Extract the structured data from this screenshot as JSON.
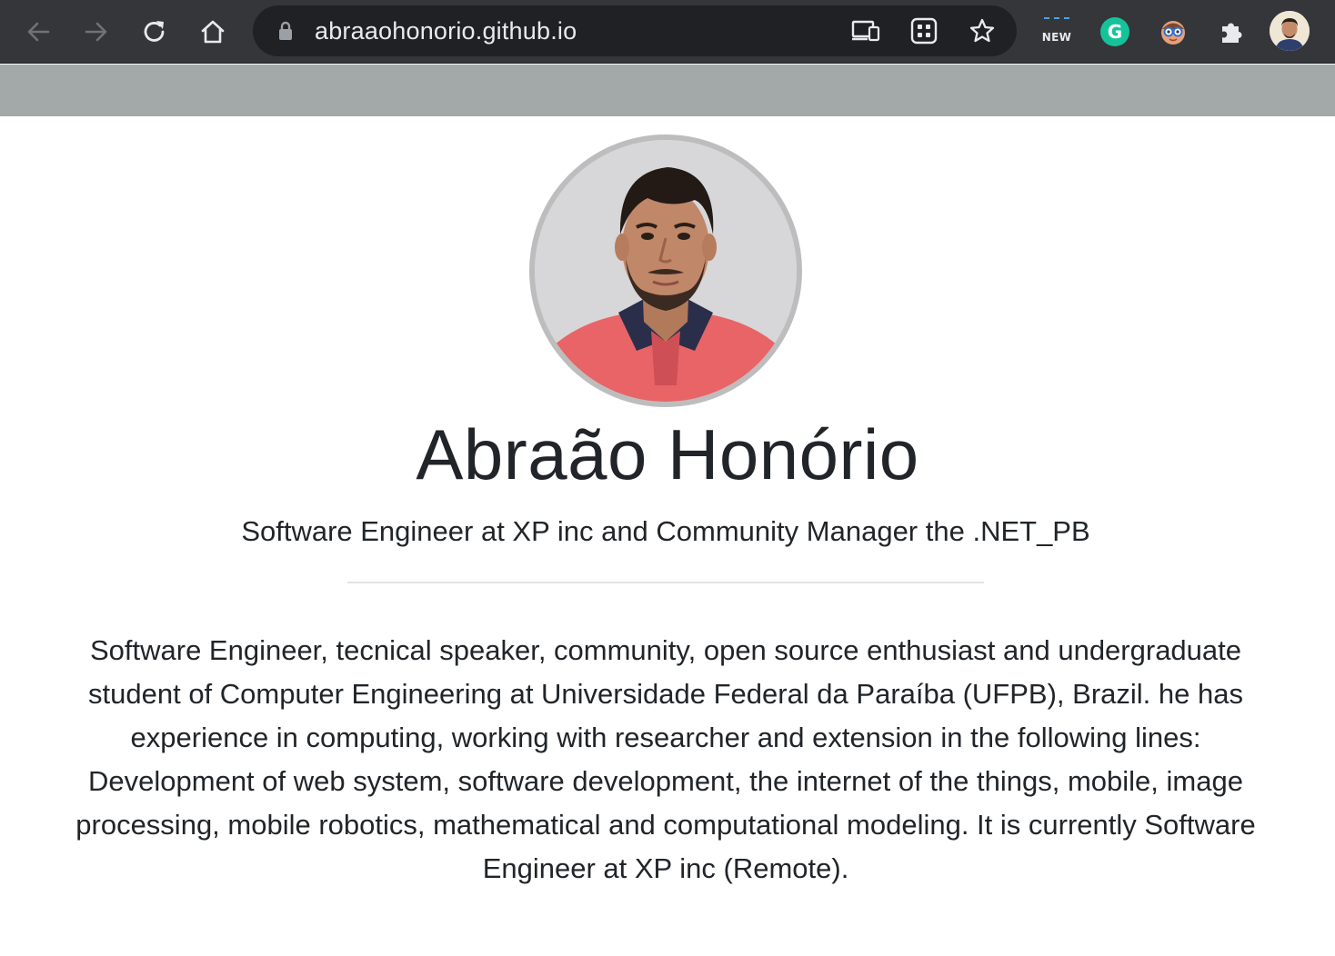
{
  "browser": {
    "url": "abraaohonorio.github.io",
    "extensions": {
      "new_badge": "NEW",
      "grammarly_letter": "G"
    },
    "icons": {
      "back": "arrow-left-icon",
      "forward": "arrow-right-icon",
      "reload": "reload-icon",
      "home": "home-icon",
      "lock": "lock-icon",
      "cast": "devices-icon",
      "apps": "grid-icon",
      "bookmark": "star-icon",
      "extensions": "puzzle-icon"
    }
  },
  "profile": {
    "name": "Abraão Honório",
    "tagline": "Software Engineer at XP inc and Community Manager the .NET_PB",
    "bio": "Software Engineer, tecnical speaker, community, open source enthusiast and undergraduate student of Computer Engineering at Universidade Federal da Paraíba (UFPB), Brazil. he has experience in computing, working with researcher and extension in the following lines: Development of web system, software development, the internet of the things, mobile, image processing, mobile robotics, mathematical and computational modeling. It is currently Software Engineer at XP inc (Remote)."
  },
  "colors": {
    "toolbar": "#35363a",
    "omnibox": "#202124",
    "banner": "#a3a8a8",
    "text": "#212529"
  }
}
